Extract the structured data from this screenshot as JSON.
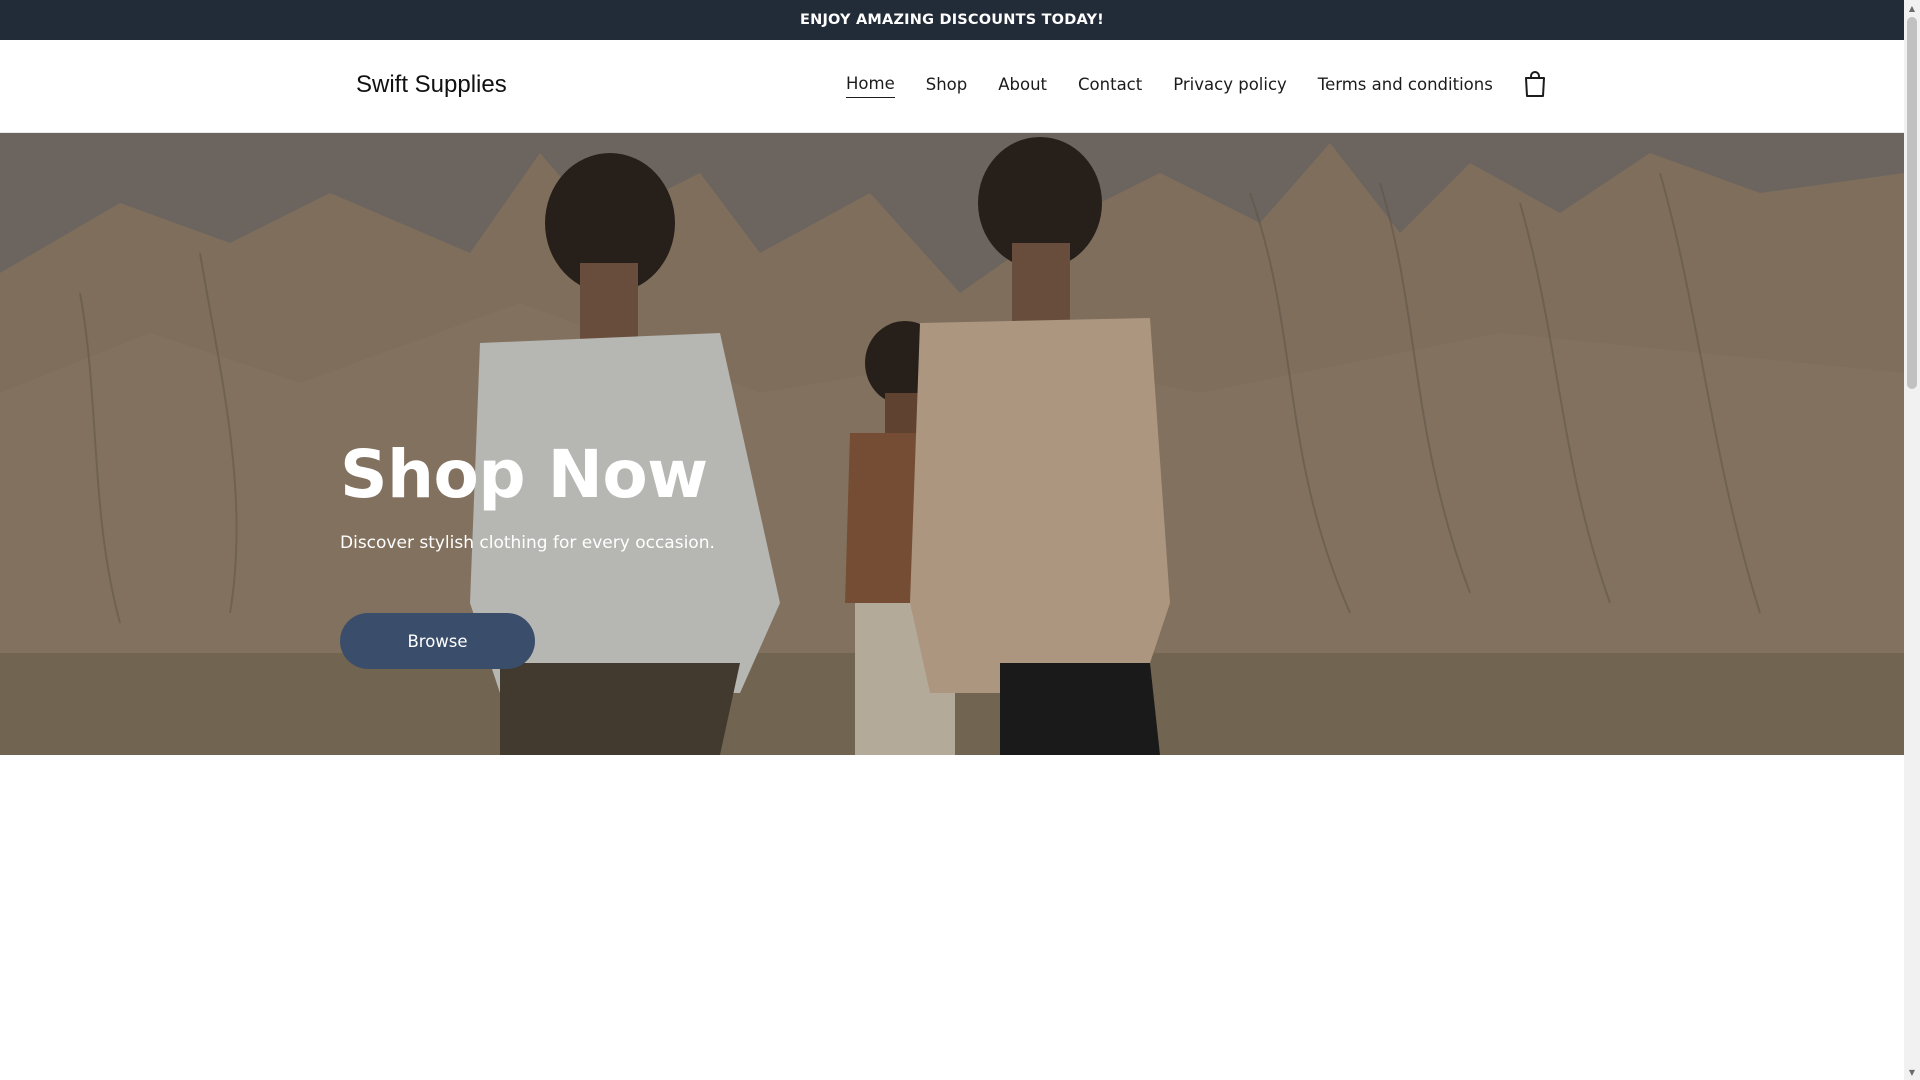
{
  "announcement": {
    "text": "ENJOY AMAZING DISCOUNTS TODAY!"
  },
  "header": {
    "brand": "Swift Supplies",
    "nav": [
      {
        "label": "Home",
        "active": true
      },
      {
        "label": "Shop",
        "active": false
      },
      {
        "label": "About",
        "active": false
      },
      {
        "label": "Contact",
        "active": false
      },
      {
        "label": "Privacy policy",
        "active": false
      },
      {
        "label": "Terms and conditions",
        "active": false
      }
    ],
    "cart_icon": "shopping-bag-icon"
  },
  "hero": {
    "title": "Shop Now",
    "subtitle": "Discover stylish clothing for every occasion.",
    "cta_label": "Browse",
    "image": "three-models-desert-photo"
  },
  "scrollbar": {
    "up_icon": "scroll-up-arrow-icon",
    "down_icon": "scroll-down-arrow-icon"
  },
  "colors": {
    "announcement_bg": "#222b38",
    "cta_bg": "#3a4e6b",
    "text_dark": "#1c1c1c"
  }
}
